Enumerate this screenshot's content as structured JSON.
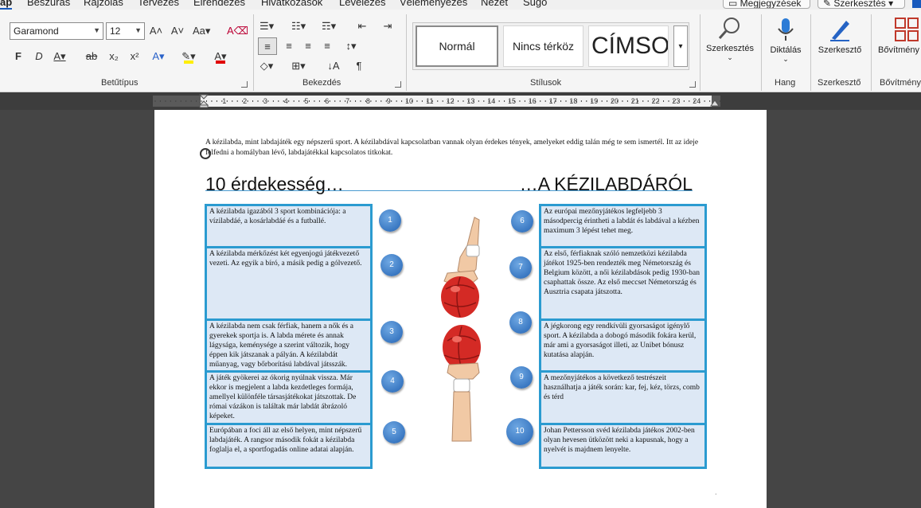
{
  "tabs": [
    "ap",
    "Beszúrás",
    "Rajzolás",
    "Tervezés",
    "Elrendezés",
    "Hivatkozások",
    "Levelezés",
    "Véleményezés",
    "Nézet",
    "Súgó"
  ],
  "top_buttons": {
    "comments": "Megjegyzések",
    "editing": "Szerkesztés"
  },
  "font": {
    "name": "Garamond",
    "size": "12",
    "group_label": "Betűtípus"
  },
  "paragraph": {
    "group_label": "Bekezdés"
  },
  "styles": {
    "items": [
      "Normál",
      "Nincs térköz",
      "CÍMSO"
    ],
    "group_label": "Stílusok"
  },
  "right_groups": {
    "find_label": "Szerkesztés",
    "dictate_label": "Diktálás",
    "voice_group": "Hang",
    "editor_label": "Szerkesztő",
    "editor_group": "Szerkesztő",
    "addins_label": "Bővítmény",
    "addins_group": "Bővítmény"
  },
  "ruler": {
    "numbers": [
      "1",
      "2",
      "3",
      "4",
      "5",
      "6",
      "7",
      "8",
      "9",
      "10",
      "11",
      "12",
      "13",
      "14",
      "15",
      "16",
      "17",
      "18",
      "19",
      "20",
      "21",
      "22",
      "23",
      "24"
    ]
  },
  "document": {
    "intro": "A kézilabda, mint labdajáték egy népszerű sport. A kézilabdával kapcsolatban vannak olyan érdekes tények, amelyeket eddig talán még te sem ismertél. Itt az ideje felfedni a homályban lévő, labdajátékkal kapcsolatos titkokat.",
    "title_left": "10 érdekesség…",
    "title_right": "…A KÉZILABDÁRÓL",
    "facts": [
      {
        "num": "1",
        "text": "A kézilabda igazából 3 sport kombinációja: a vízilabdáé, a kosárlabdáé és a futballé."
      },
      {
        "num": "2",
        "text": "A kézilabda mérkőzést két egyenjogú játékvezető vezeti. Az egyik a bíró, a másik pedig a gólvezető."
      },
      {
        "num": "3",
        "text": "A kézilabda nem csak férfiak, hanem a nők és a gyerekek sportja is. A labda mérete és annak lágysága, keménysége a szerint változik, hogy éppen kik játszanak a pályán. A kézilabdát műanyag, vagy bőrborítású labdával játsszák."
      },
      {
        "num": "4",
        "text": "A játék gyökerei az ókorig nyúlnak vissza. Már ekkor is megjelent a labda kezdetleges formája, amellyel különféle társasjátékokat játszottak. De római vázákon is találtak már labdát ábrázoló képeket."
      },
      {
        "num": "5",
        "text": "Európában a foci áll az első helyen, mint népszerű labdajáték. A rangsor második fokát a kézilabda foglalja el, a sportfogadás online adatai alapján."
      },
      {
        "num": "6",
        "text": "Az európai mezőnyjátékos legfeljebb 3 másodpercig érintheti a labdát és labdával a kézben maximum 3 lépést tehet meg."
      },
      {
        "num": "7",
        "text": "Az első, férfiaknak szóló nemzetközi kézilabda játékot 1925-ben rendezték meg Németország és Belgium között, a női kézilabdások pedig 1930-ban csaphattak össze. Az első meccset Németország és Ausztria csapata játszotta."
      },
      {
        "num": "8",
        "text": "A jégkorong egy rendkívüli gyorsaságot igénylő sport. A kézilabda a dobogó második fokára kerül, már ami a gyorsaságot illeti, az Unibet bónusz kutatása alapján."
      },
      {
        "num": "9",
        "text": "A mezőnyjátékos a következő testrészeit használhatja a játék során: kar, fej, kéz, törzs, comb és térd"
      },
      {
        "num": "10",
        "text": "Johan Pettersson svéd kézilabda játékos 2002-ben olyan hevesen ütközött neki a kapusnak, hogy a nyelvét is majdnem lenyelte."
      }
    ]
  },
  "colors": {
    "accent": "#185abd",
    "box_border": "#2b9bd0",
    "box_fill": "#dde8f5",
    "ball": "#d42a25"
  }
}
